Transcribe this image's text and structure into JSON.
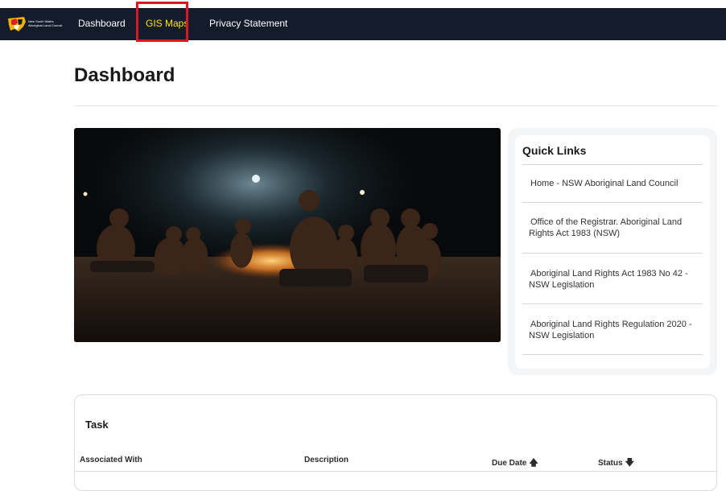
{
  "topbar": {
    "logo_text_1": "New South Wales",
    "logo_text_2": "Aboriginal Land Council",
    "nav": {
      "dashboard": "Dashboard",
      "gis_maps": "GIS Maps",
      "privacy": "Privacy Statement"
    }
  },
  "page": {
    "title": "Dashboard"
  },
  "quick_links": {
    "title": "Quick Links",
    "items": [
      {
        "label": "Home - NSW Aboriginal Land Council"
      },
      {
        "label": "Office of the Registrar. Aboriginal Land Rights Act 1983 (NSW)"
      },
      {
        "label": "Aboriginal Land Rights Act 1983 No 42 - NSW Legislation"
      },
      {
        "label": "Aboriginal Land Rights Regulation 2020 - NSW Legislation"
      }
    ]
  },
  "task": {
    "title": "Task",
    "columns": {
      "associated_with": "Associated With",
      "description": "Description",
      "due_date": "Due Date",
      "status": "Status"
    },
    "sort_icons": {
      "due_date": "arrow-up-icon",
      "status": "arrow-down-icon"
    }
  },
  "colors": {
    "topbar": "#141b2b",
    "active_nav": "#ffe600",
    "highlight_border": "#e0161e"
  }
}
